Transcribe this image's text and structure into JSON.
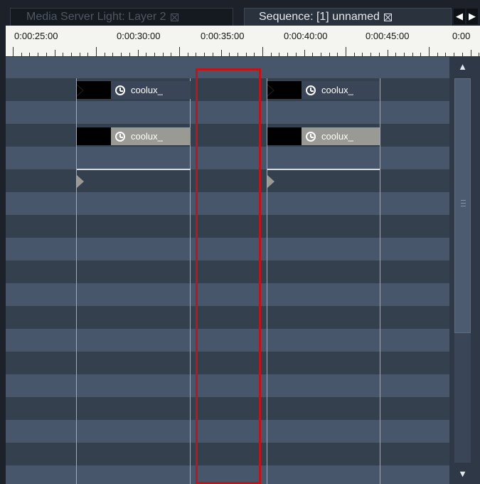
{
  "tabs": [
    {
      "label": "Media Server Light: Layer 2",
      "active": false
    },
    {
      "label": "Sequence: [1] unnamed",
      "active": true
    }
  ],
  "nav": {
    "left_icon": "arrow-left-icon",
    "right_icon": "arrow-right-icon",
    "left_glyph": "◀",
    "right_glyph": "▶"
  },
  "ruler": {
    "labels": [
      "0:00:25:00",
      "0:00:30:00",
      "0:00:35:00",
      "0:00:40:00",
      "0:00:45:00",
      "0:00"
    ]
  },
  "clips": [
    {
      "label": "coolux_",
      "style": "dark"
    },
    {
      "label": "coolux_",
      "style": "light"
    },
    {
      "label": "coolux_",
      "style": "dark"
    },
    {
      "label": "coolux_",
      "style": "light"
    }
  ],
  "scrollbar": {
    "up_glyph": "▲",
    "down_glyph": "▼"
  },
  "colors": {
    "selection": "#c0141a",
    "row_dark": "#35404f",
    "row_light": "#47566b",
    "ruler_bg": "#f4f4f0"
  }
}
